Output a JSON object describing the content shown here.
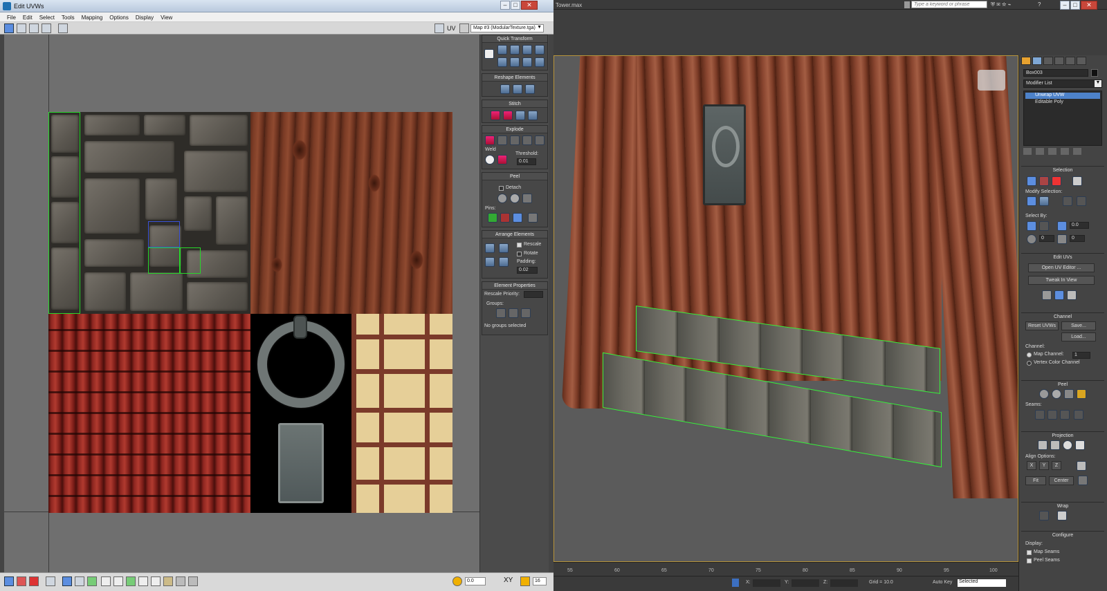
{
  "uv_editor": {
    "title": "Edit UVWs",
    "menu": [
      "File",
      "Edit",
      "Select",
      "Tools",
      "Mapping",
      "Options",
      "Display",
      "View"
    ],
    "uv_label": "UV",
    "map_select": "Map #3 (ModularTexture.tga)",
    "bottom": {
      "value1": "0.0",
      "xy": "XY",
      "value2": "16"
    },
    "rollouts": {
      "quick_transform": "Quick Transform",
      "reshape": "Reshape Elements",
      "stitch": "Stitch",
      "explode": "Explode",
      "weld": "Weld",
      "threshold_label": "Threshold:",
      "threshold_value": "0.01",
      "peel": "Peel",
      "detach": "Detach",
      "pins": "Pins:",
      "arrange": "Arrange Elements",
      "rescale": "Rescale",
      "rotate": "Rotate",
      "padding_label": "Padding:",
      "padding_value": "0.02",
      "element_props": "Element Properties",
      "rescale_priority": "Rescale Priority:",
      "groups": "Groups:",
      "no_groups": "No groups selected"
    }
  },
  "max": {
    "file_title": "Tower.max",
    "search_placeholder": "Type a keyword or phrase",
    "object_name": "Box003",
    "modifier_list": "Modifier List",
    "stack": [
      "Unwrap UVW",
      "Editable Poly"
    ],
    "ruler_ticks": [
      "55",
      "60",
      "65",
      "70",
      "75",
      "80",
      "85",
      "90",
      "95",
      "100"
    ],
    "status": {
      "x": "X:",
      "y": "Y:",
      "z": "Z:",
      "grid": "Grid = 10.0",
      "autokey": "Auto Key",
      "selected": "Selected"
    },
    "panel": {
      "selection": "Selection",
      "modify_selection": "Modify Selection:",
      "select_by": "Select By:",
      "sel_val1": "0.0",
      "sel_val2": "0",
      "sel_val3": "0",
      "edit_uvs": "Edit UVs",
      "open_uv_editor": "Open UV Editor ...",
      "tweak_in_view": "Tweak In View",
      "channel": "Channel",
      "reset_uvws": "Reset UVWs",
      "save": "Save...",
      "load": "Load...",
      "channel_label": "Channel:",
      "map_channel": "Map Channel:",
      "map_channel_val": "1",
      "vertex_color_channel": "Vertex Color Channel",
      "peel": "Peel",
      "seams": "Seams:",
      "projection": "Projection",
      "align_options": "Align Options:",
      "align_x": "X",
      "align_y": "Y",
      "align_z": "Z",
      "fit": "Fit",
      "center": "Center",
      "wrap": "Wrap",
      "configure": "Configure",
      "display": "Display:",
      "map_seams": "Map Seams",
      "peel_seams": "Peel Seams"
    }
  }
}
